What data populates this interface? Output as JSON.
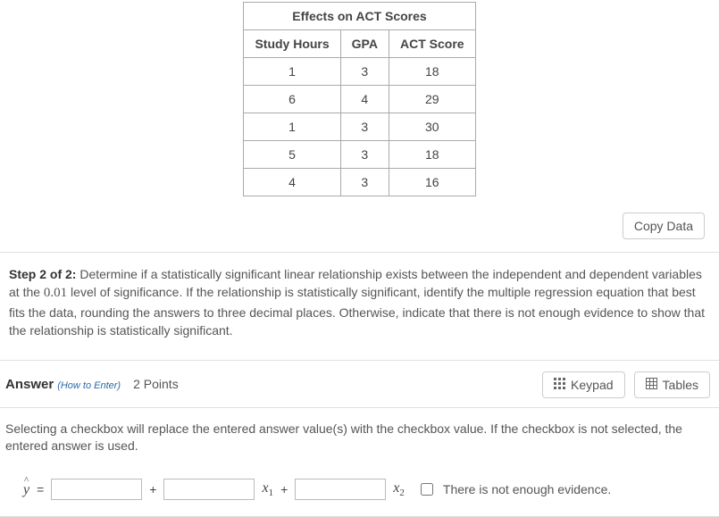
{
  "table": {
    "title": "Effects on ACT Scores",
    "headers": [
      "Study Hours",
      "GPA",
      "ACT Score"
    ],
    "rows": [
      [
        "1",
        "3",
        "18"
      ],
      [
        "6",
        "4",
        "29"
      ],
      [
        "1",
        "3",
        "30"
      ],
      [
        "5",
        "3",
        "18"
      ],
      [
        "4",
        "3",
        "16"
      ]
    ]
  },
  "copy_button": "Copy Data",
  "step": {
    "label": "Step 2 of 2:",
    "text_before_num": " Determine if a statistically significant linear relationship exists between the independent and dependent variables at the ",
    "significance": "0.01",
    "text_after_num": " level of significance. If the relationship is statistically significant, identify the multiple regression equation that best fits the data, rounding the answers to three decimal places. Otherwise, indicate that there is not enough evidence to show that the relationship is statistically significant."
  },
  "answer_bar": {
    "label": "Answer",
    "how_to_enter": "(How to Enter)",
    "points": "2 Points",
    "keypad": "Keypad",
    "tables": "Tables"
  },
  "answer_body": {
    "hint": "Selecting a checkbox will replace the entered answer value(s) with the checkbox value. If the checkbox is not selected, the entered answer is used.",
    "checkbox_label": "There is not enough evidence."
  },
  "chart_data": {
    "type": "table",
    "title": "Effects on ACT Scores",
    "columns": [
      "Study Hours",
      "GPA",
      "ACT Score"
    ],
    "rows": [
      [
        1,
        3,
        18
      ],
      [
        6,
        4,
        29
      ],
      [
        1,
        3,
        30
      ],
      [
        5,
        3,
        18
      ],
      [
        4,
        3,
        16
      ]
    ]
  }
}
